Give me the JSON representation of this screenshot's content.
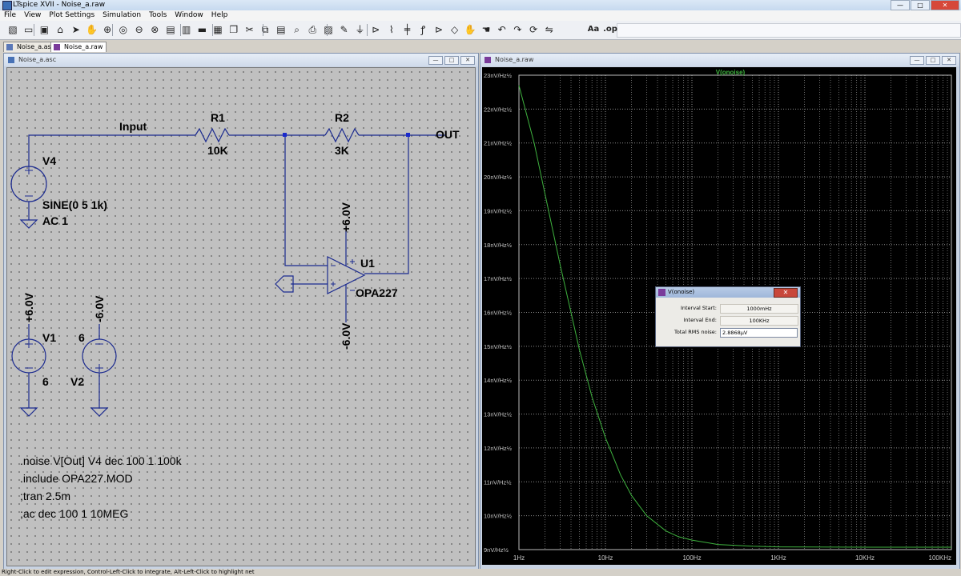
{
  "app": {
    "title": "LTspice XVII - Noise_a.raw"
  },
  "window_controls": {
    "min": "—",
    "max": "□",
    "close": "✕"
  },
  "menu": [
    "File",
    "View",
    "Plot Settings",
    "Simulation",
    "Tools",
    "Window",
    "Help"
  ],
  "toolbar": {
    "icons": [
      "new-schematic-icon",
      "open-icon",
      "save-icon",
      "control-panel-icon",
      "run-icon",
      "halt-icon",
      "zoom-in-icon",
      "zoom-pan-icon",
      "zoom-out-icon",
      "zoom-cancel-icon",
      "autorange-icon",
      "plot-settings-icon",
      "tile-horizontal-icon",
      "tile-vertical-icon",
      "cascade-icon",
      "cut-icon",
      "copy-icon",
      "paste-icon",
      "find-icon",
      "print-icon",
      "print-setup-icon",
      "draw-wire-icon",
      "ground-icon",
      "label-net-icon",
      "resistor-icon",
      "capacitor-icon",
      "inductor-icon",
      "diode-icon",
      "component-icon",
      "move-icon",
      "drag-icon",
      "undo-icon",
      "redo-icon",
      "rotate-icon",
      "mirror-icon",
      "text-icon",
      "spice-directive-icon"
    ],
    "text_label": "Aa",
    "directive_label": ".op"
  },
  "tabs": [
    {
      "label": "Noise_a.asc",
      "active": false
    },
    {
      "label": "Noise_a.raw",
      "active": true
    }
  ],
  "schematic": {
    "window_title": "Noise_a.asc",
    "labels": {
      "input": "Input",
      "out": "OUT",
      "r1_name": "R1",
      "r1_value": "10K",
      "r2_name": "R2",
      "r2_value": "3K",
      "v4_name": "V4",
      "v4_value1": "SINE(0 5 1k)",
      "v4_value2": "AC 1",
      "u1_name": "U1",
      "u1_model": "OPA227",
      "pos_supply": "+6.0V",
      "neg_supply": "-6.0V",
      "v1_name": "V1",
      "v1_value": "6",
      "v1_top": "6",
      "v2_name": "V2",
      "v1_rail": "+6.0V",
      "v2_rail": "-6.0V"
    },
    "directives": [
      ".noise V[Out] V4 dec 100 1 100k",
      ".include OPA227.MOD",
      ";tran 2.5m",
      ";ac dec 100 1 10MEG"
    ]
  },
  "plot": {
    "window_title": "Noise_a.raw",
    "trace_name": "V(onoise)",
    "trace_color": "#3fb33f",
    "y_ticks": [
      "23nV/Hz½",
      "22nV/Hz½",
      "21nV/Hz½",
      "20nV/Hz½",
      "19nV/Hz½",
      "18nV/Hz½",
      "17nV/Hz½",
      "16nV/Hz½",
      "15nV/Hz½",
      "14nV/Hz½",
      "13nV/Hz½",
      "12nV/Hz½",
      "11nV/Hz½",
      "10nV/Hz½",
      "9nV/Hz½"
    ],
    "x_ticks": [
      "1Hz",
      "10Hz",
      "100Hz",
      "1KHz",
      "10KHz",
      "100KHz"
    ]
  },
  "dialog": {
    "title": "V(onoise)",
    "interval_start_label": "Interval Start:",
    "interval_start": "1000mHz",
    "interval_end_label": "Interval End:",
    "interval_end": "100KHz",
    "rms_label": "Total RMS noise:",
    "rms_value": "2.8868µV"
  },
  "status_bar": "Right-Click to edit expression, Control-Left-Click to integrate, Alt-Left-Click to highlight net",
  "chart_data": {
    "type": "line",
    "title": "",
    "xlabel": "",
    "ylabel": "",
    "x_scale": "log",
    "xlim": [
      1,
      100000
    ],
    "ylim": [
      9,
      23
    ],
    "grid": true,
    "series": [
      {
        "name": "V(onoise)",
        "color": "#3fb33f",
        "x": [
          1,
          1.5,
          2,
          3,
          4,
          5,
          7,
          10,
          15,
          20,
          30,
          50,
          70,
          100,
          200,
          500,
          1000,
          10000,
          100000
        ],
        "y": [
          22.7,
          21.0,
          19.5,
          17.4,
          16.0,
          14.9,
          13.5,
          12.3,
          11.2,
          10.6,
          10.0,
          9.55,
          9.38,
          9.28,
          9.15,
          9.1,
          9.08,
          9.07,
          9.07
        ]
      }
    ]
  }
}
